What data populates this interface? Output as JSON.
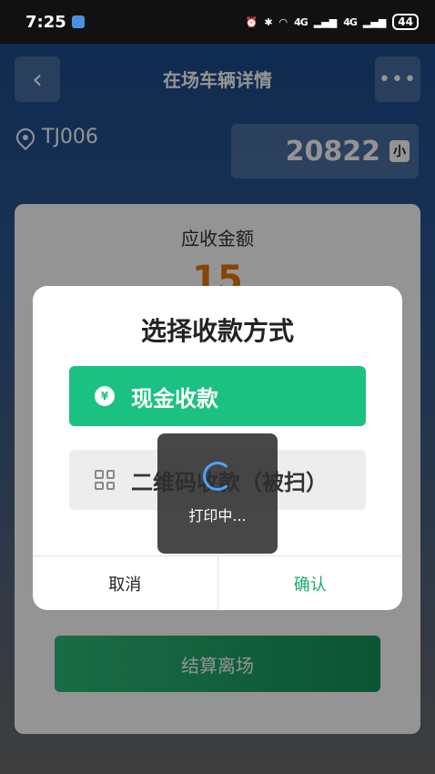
{
  "status_bar": {
    "time": "7:25",
    "signal_1": "4G",
    "signal_2": "4G",
    "battery": "44"
  },
  "nav": {
    "title": "在场车辆详情",
    "back_glyph": "‹",
    "more_glyph": "•••"
  },
  "vehicle": {
    "slot": "TJ006",
    "plate_text": "20822",
    "plate_size": "小"
  },
  "card": {
    "amount_label": "应收金额",
    "amount_value": "15",
    "settle_label": "结算离场"
  },
  "dialog": {
    "title": "选择收款方式",
    "cash_label": "现金收款",
    "cash_icon_glyph": "¥",
    "qr_label": "二维码收款（被扫）",
    "cancel_label": "取消",
    "confirm_label": "确认"
  },
  "toast": {
    "text": "打印中..."
  },
  "colors": {
    "accent": "#1bc180",
    "confirm": "#1bab70",
    "spinner": "#4da3ff"
  }
}
